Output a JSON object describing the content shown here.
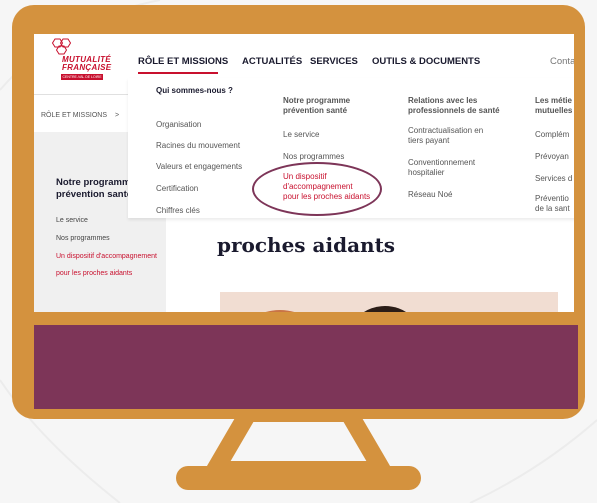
{
  "brand": {
    "line1": "MUTUALITÉ",
    "line2": "FRANÇAISE",
    "strip": "CENTRE-VAL DE LOIRE",
    "color": "#c8102e"
  },
  "nav": {
    "items": [
      "RÔLE ET MISSIONS",
      "ACTUALITÉS",
      "SERVICES",
      "OUTILS & DOCUMENTS",
      "Conta"
    ],
    "active_index": 0
  },
  "breadcrumb": {
    "label": "RÔLE ET MISSIONS",
    "chevron": ">"
  },
  "sidebar": {
    "title": "Notre programme prévention santé",
    "links": [
      "Le service",
      "Nos programmes",
      "Un dispositif d'accompagnement",
      "pour les proches aidants"
    ],
    "active_indices": [
      2,
      3
    ]
  },
  "page": {
    "heading": "proches aidants"
  },
  "dropdown": {
    "columns": [
      {
        "heading": "Qui sommes-nous ?",
        "items": [
          "Organisation",
          "Racines du mouvement",
          "Valeurs et engagements",
          "Certification",
          "Chiffres clés"
        ]
      },
      {
        "heading_lines": [
          "Notre programme",
          "prévention santé"
        ],
        "items": [
          "Le service",
          "Nos programmes"
        ],
        "active_lines": [
          "Un dispositif",
          "d'accompagnement",
          "pour les proches aidants"
        ]
      },
      {
        "heading_lines": [
          "Relations avec les",
          "professionnels de santé"
        ],
        "items": [
          [
            "Contractualisation en",
            "tiers payant"
          ],
          [
            "Conventionnement",
            "hospitalier"
          ],
          [
            "Réseau Noé"
          ]
        ]
      },
      {
        "heading_lines": [
          "Les métie",
          "mutuelles"
        ],
        "items": [
          "Complém",
          "Prévoyan",
          "Services d",
          "Préventio",
          "de la sant"
        ]
      }
    ]
  },
  "colors": {
    "monitor_frame": "#d4923e",
    "purple_panel": "#7d3558",
    "active_link": "#c8102e",
    "text_dark": "#1a1a2e"
  }
}
